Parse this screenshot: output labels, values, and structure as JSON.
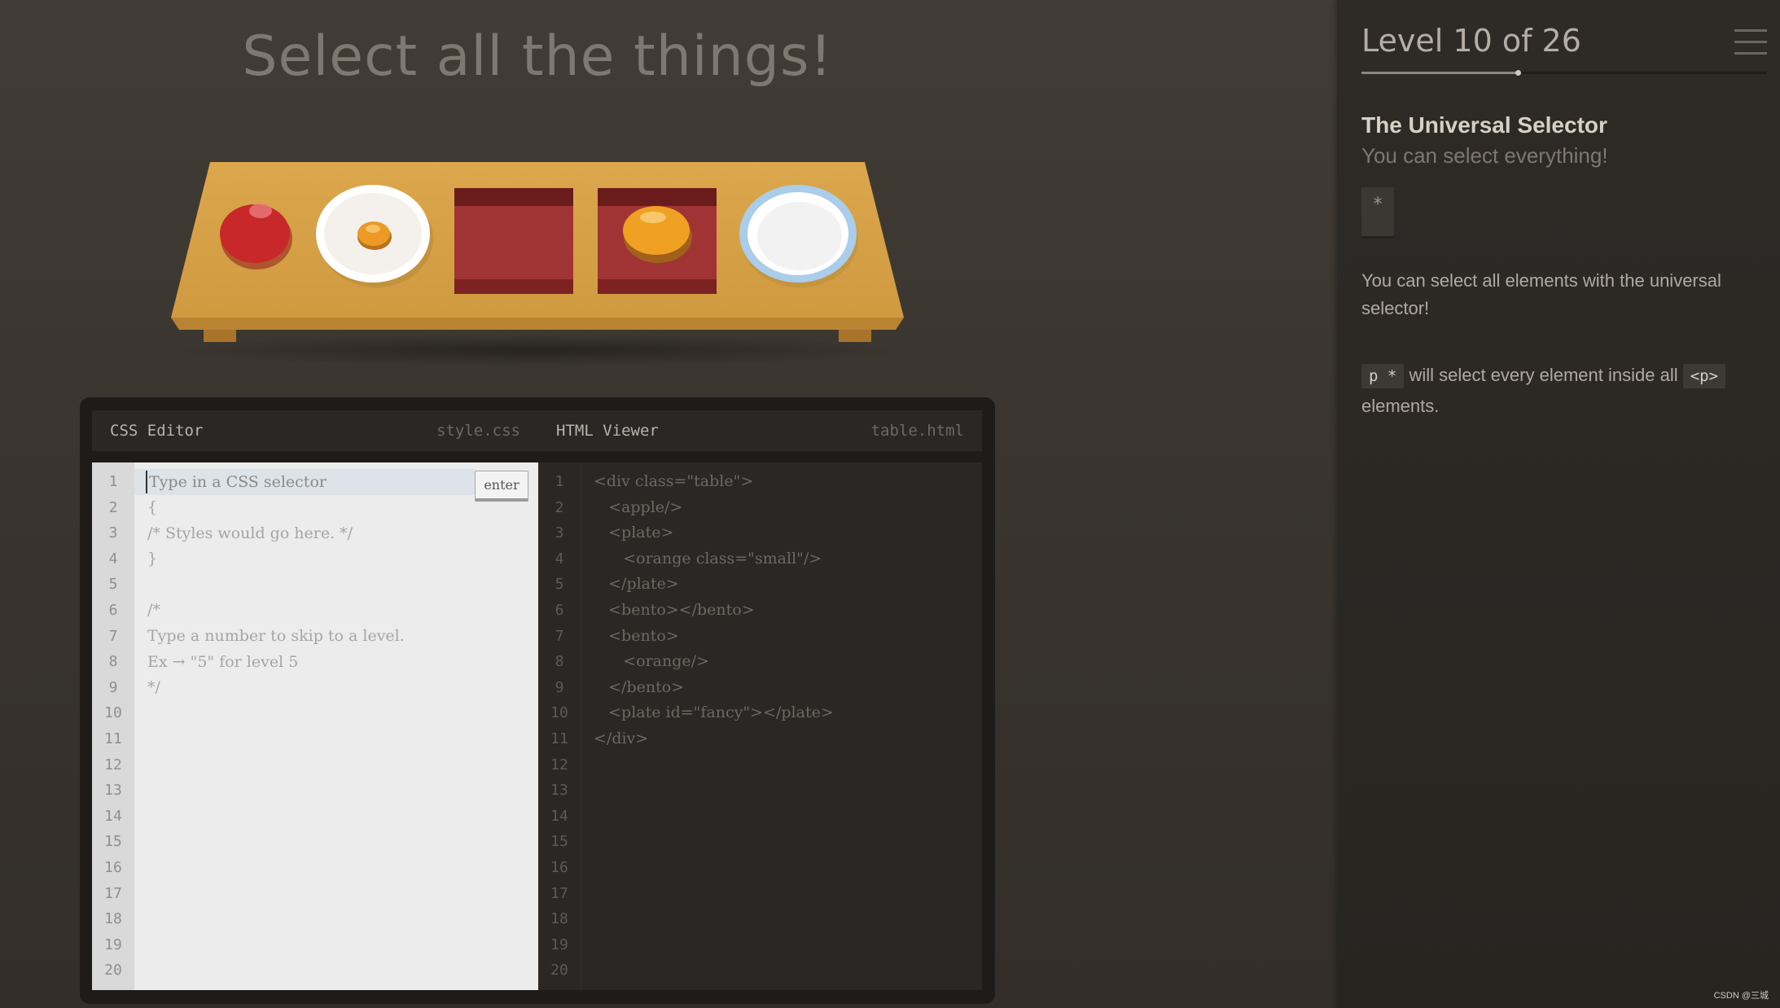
{
  "game": {
    "title": "Select all the things!"
  },
  "table": {
    "items": [
      "apple",
      "plate with small orange",
      "bento",
      "bento with orange",
      "fancy plate"
    ]
  },
  "css_editor": {
    "header": "CSS Editor",
    "filename": "style.css",
    "input_placeholder": "Type in a CSS selector",
    "enter_label": "enter",
    "line_numbers": [
      "1",
      "2",
      "3",
      "4",
      "5",
      "6",
      "7",
      "8",
      "9",
      "10",
      "11",
      "12",
      "13",
      "14",
      "15",
      "16",
      "17",
      "18",
      "19",
      "20"
    ],
    "lines": [
      "{",
      "/* Styles would go here. */",
      "}",
      "",
      "/*",
      "Type a number to skip to a level.",
      "Ex → \"5\" for level 5",
      "*/"
    ]
  },
  "html_viewer": {
    "header": "HTML Viewer",
    "filename": "table.html",
    "line_numbers": [
      "1",
      "2",
      "3",
      "4",
      "5",
      "6",
      "7",
      "8",
      "9",
      "10",
      "11",
      "12",
      "13",
      "14",
      "15",
      "16",
      "17",
      "18",
      "19",
      "20"
    ],
    "lines": [
      "<div class=\"table\">",
      "   <apple/>",
      "   <plate>",
      "      <orange class=\"small\"/>",
      "   </plate>",
      "   <bento></bento>",
      "   <bento>",
      "      <orange/>",
      "   </bento>",
      "   <plate id=\"fancy\"></plate>",
      "</div>"
    ]
  },
  "sidebar": {
    "level_label": "Level 10 of 26",
    "progress": 0.385,
    "selector_name": "The Universal Selector",
    "selector_subtitle": "You can select everything!",
    "syntax": "*",
    "description": "You can select all elements with the universal selector!",
    "example_code": "p *",
    "example_text_1": "will select every element inside all",
    "example_tag": "<p>",
    "example_text_2": "elements."
  },
  "footer": {
    "watermark": "CSDN @三城"
  },
  "colors": {
    "background": "#3a352f",
    "table": "#d8a24a",
    "apple": "#c8282a",
    "orange": "#f0a023",
    "bento": "#8f2a2a",
    "fancy_plate_rim": "#a9cdea"
  }
}
